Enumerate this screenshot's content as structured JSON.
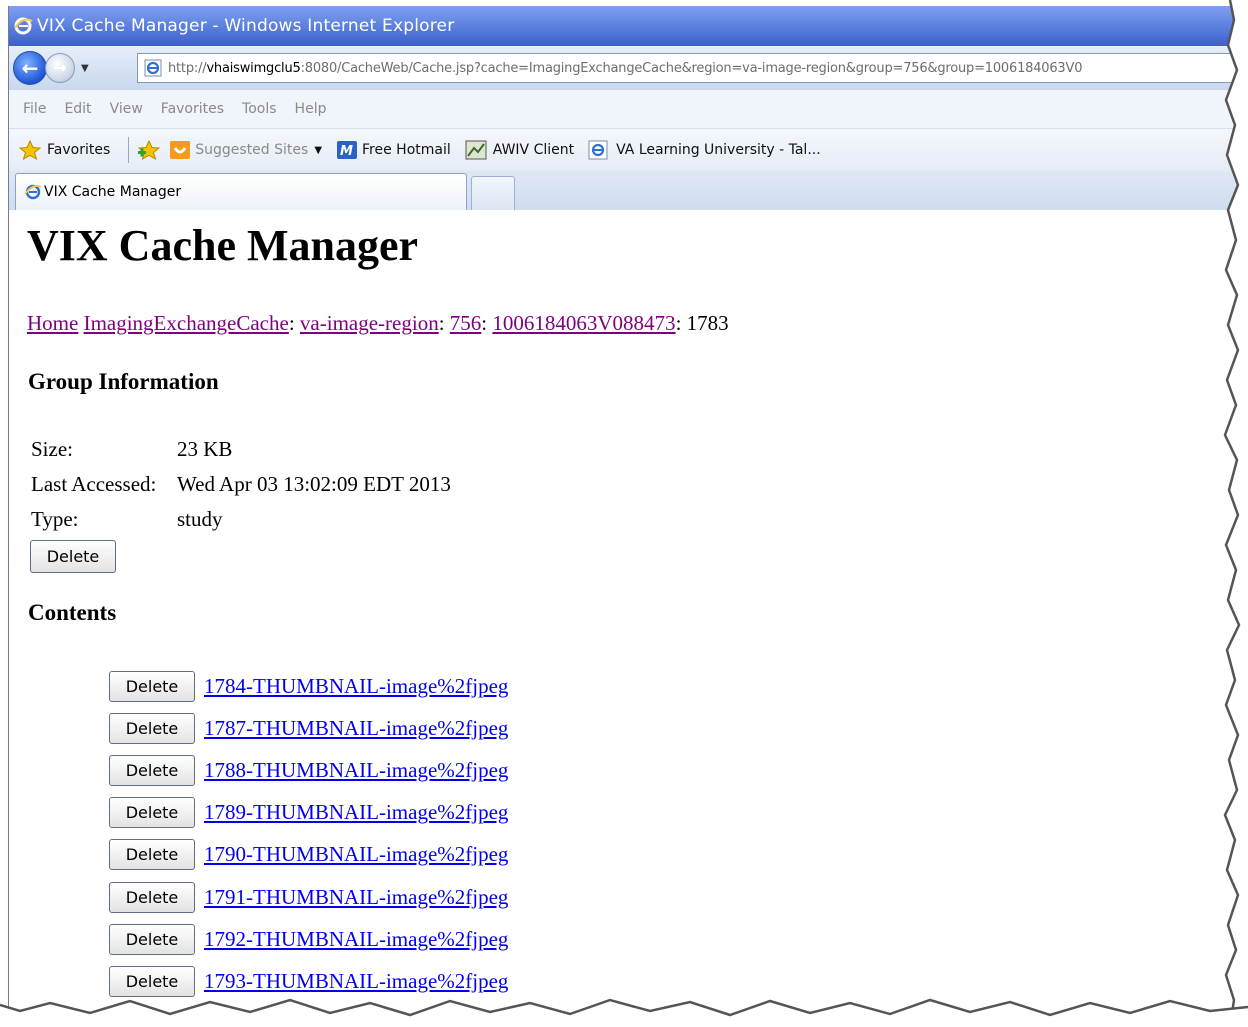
{
  "window": {
    "title": "VIX Cache Manager - Windows Internet Explorer"
  },
  "address_bar": {
    "url_prefix": "http://",
    "url_host": "vhaiswimgclu5",
    "url_rest": ":8080/CacheWeb/Cache.jsp?cache=ImagingExchangeCache&region=va-image-region&group=756&group=1006184063V0"
  },
  "menu": [
    "File",
    "Edit",
    "View",
    "Favorites",
    "Tools",
    "Help"
  ],
  "favorites_bar": {
    "favorites_label": "Favorites",
    "items": [
      "Suggested Sites",
      "Free Hotmail",
      "AWIV Client",
      "VA Learning University - Tal..."
    ]
  },
  "tab": {
    "active_label": "VIX Cache Manager"
  },
  "page": {
    "heading": "VIX Cache Manager",
    "breadcrumb": {
      "items": [
        "Home",
        "ImagingExchangeCache",
        "va-image-region",
        "756",
        "1006184063V088473"
      ],
      "current": "1783"
    },
    "group_info": {
      "title": "Group Information",
      "rows": [
        {
          "label": "Size:",
          "value": "23 KB"
        },
        {
          "label": "Last Accessed:",
          "value": "Wed Apr 03 13:02:09 EDT 2013"
        },
        {
          "label": "Type:",
          "value": "study"
        }
      ],
      "delete_label": "Delete"
    },
    "contents": {
      "title": "Contents",
      "delete_label": "Delete",
      "items": [
        "1784-THUMBNAIL-image%2fjpeg",
        "1787-THUMBNAIL-image%2fjpeg",
        "1788-THUMBNAIL-image%2fjpeg",
        "1789-THUMBNAIL-image%2fjpeg",
        "1790-THUMBNAIL-image%2fjpeg",
        "1791-THUMBNAIL-image%2fjpeg",
        "1792-THUMBNAIL-image%2fjpeg",
        "1793-THUMBNAIL-image%2fjpeg"
      ]
    }
  },
  "colors": {
    "visited_link": "#800080",
    "link": "#0000ee",
    "titlebar": "#4f73d6"
  }
}
